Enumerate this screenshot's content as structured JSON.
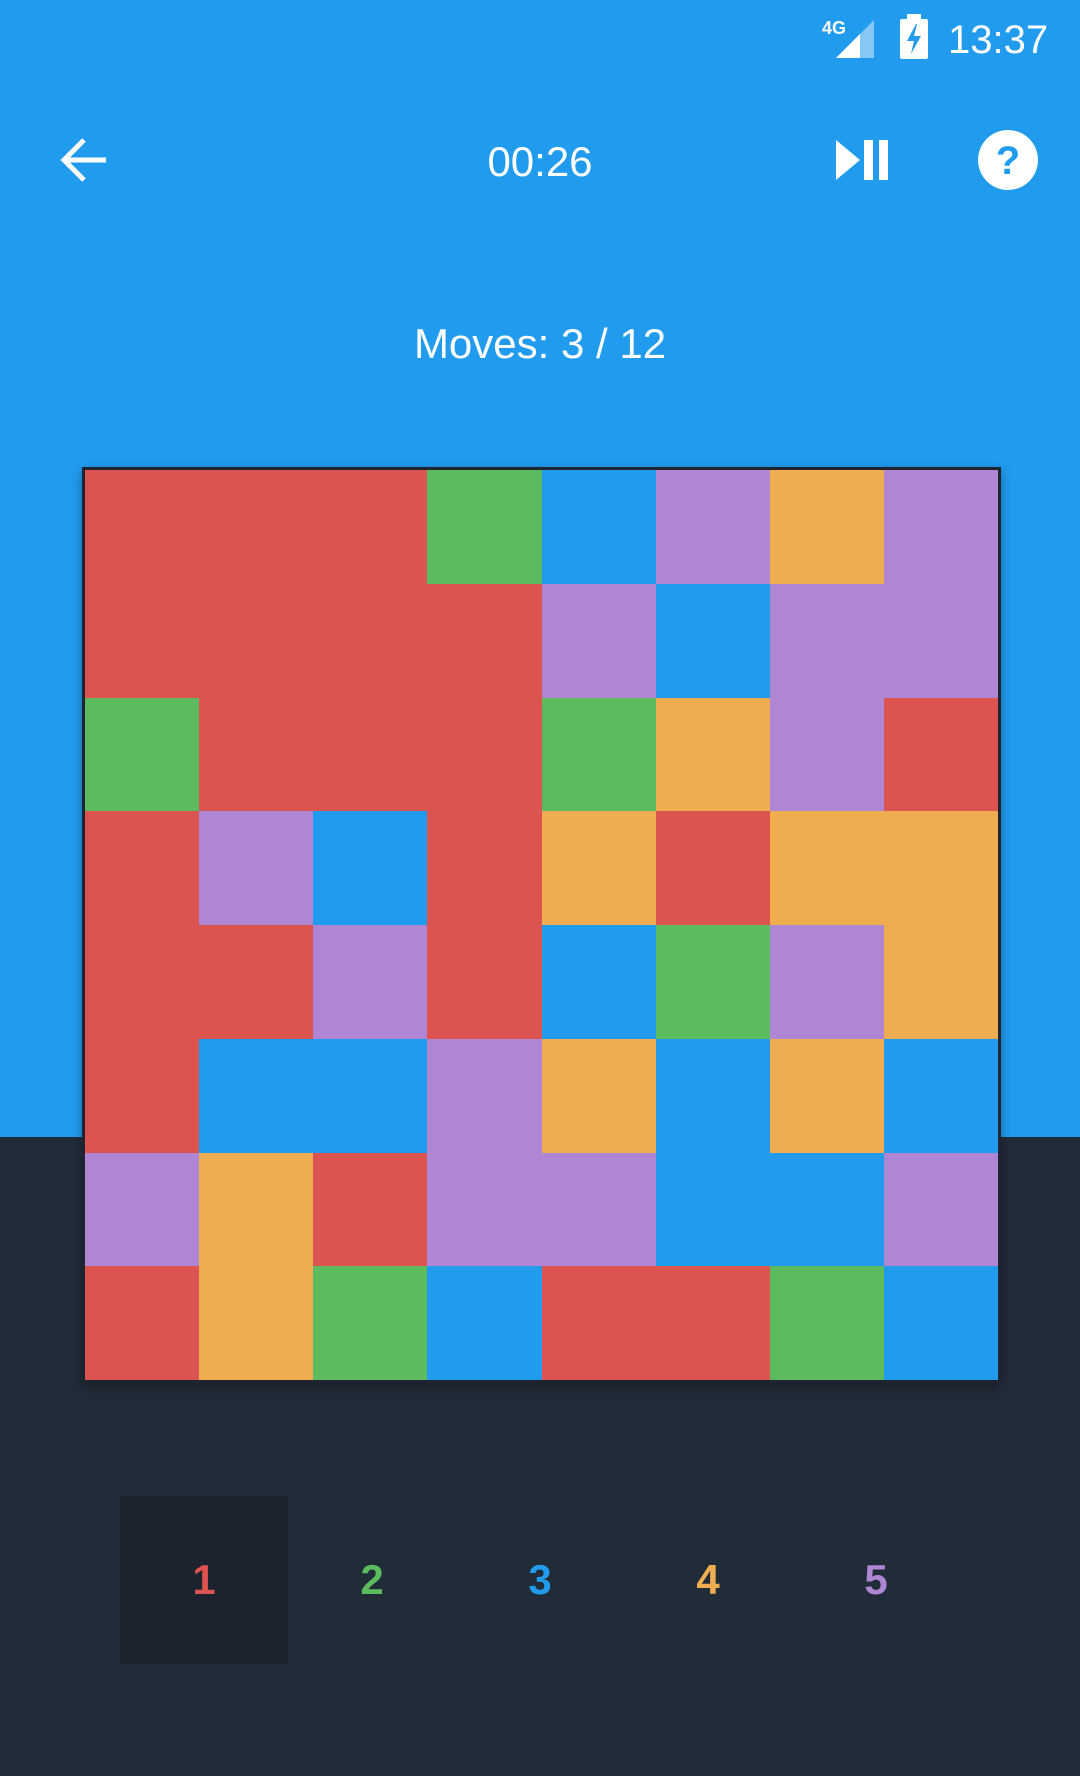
{
  "status_bar": {
    "network": "4G",
    "time": "13:37"
  },
  "toolbar": {
    "back_icon": "arrow-left-icon",
    "timer": "00:26",
    "pause_icon": "play-pause-icon",
    "help_icon": "help-circle-icon"
  },
  "moves_text": "Moves: 3 / 12",
  "colors": {
    "R": "#db544f",
    "G": "#5cba5f",
    "B": "#219bee",
    "O": "#efad4f",
    "P": "#af86d4"
  },
  "board": [
    [
      "R",
      "R",
      "R",
      "G",
      "B",
      "P",
      "O",
      "P"
    ],
    [
      "R",
      "R",
      "R",
      "R",
      "P",
      "B",
      "P",
      "P"
    ],
    [
      "G",
      "R",
      "R",
      "R",
      "G",
      "O",
      "P",
      "R"
    ],
    [
      "R",
      "P",
      "B",
      "R",
      "O",
      "R",
      "O",
      "O"
    ],
    [
      "R",
      "R",
      "P",
      "R",
      "B",
      "G",
      "P",
      "O"
    ],
    [
      "R",
      "B",
      "B",
      "P",
      "O",
      "B",
      "O",
      "B"
    ],
    [
      "P",
      "O",
      "R",
      "P",
      "P",
      "B",
      "B",
      "P"
    ],
    [
      "R",
      "O",
      "G",
      "B",
      "R",
      "R",
      "G",
      "B"
    ]
  ],
  "palette": [
    {
      "label": "1",
      "color_key": "R",
      "selected": true
    },
    {
      "label": "2",
      "color_key": "G",
      "selected": false
    },
    {
      "label": "3",
      "color_key": "B",
      "selected": false
    },
    {
      "label": "4",
      "color_key": "O",
      "selected": false
    },
    {
      "label": "5",
      "color_key": "P",
      "selected": false
    }
  ]
}
